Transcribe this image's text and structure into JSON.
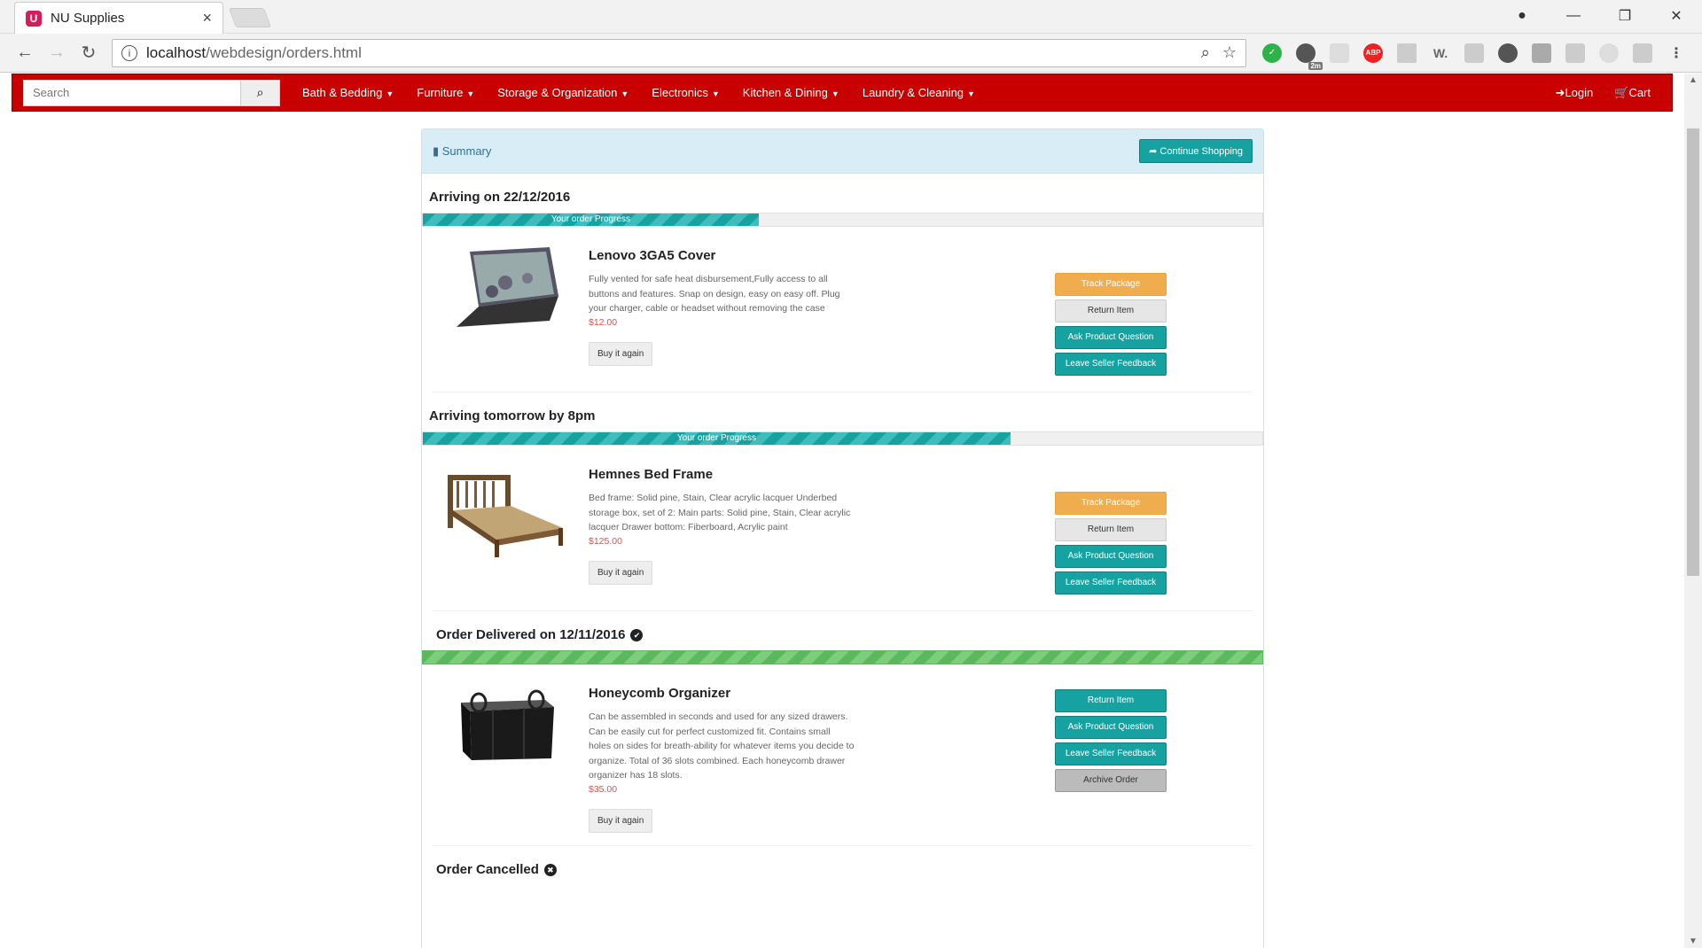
{
  "browser": {
    "tab_title": "NU Supplies",
    "favicon_text": "U",
    "url_host": "localhost",
    "url_path": "/webdesign/orders.html",
    "ext_badge": "2m"
  },
  "navbar": {
    "search_placeholder": "Search",
    "items": [
      "Bath & Bedding",
      "Furniture",
      "Storage & Organization",
      "Electronics",
      "Kitchen & Dining",
      "Laundry & Cleaning"
    ],
    "login": "Login",
    "cart": "Cart",
    "bg_color": "#c80000"
  },
  "summary": {
    "title": "Summary",
    "continue_label": "Continue Shopping"
  },
  "orders": [
    {
      "status": "Arriving on 22/12/2016",
      "progress_label": "Your order Progress",
      "progress": 0.4,
      "product": "Lenovo 3GA5 Cover",
      "description": "Fully vented for safe heat disbursement,Fully access to all buttons and features. Snap on design, easy on easy off. Plug your charger, cable or headset without removing the case",
      "price": "$12.00",
      "buy_again": "Buy it again",
      "actions": [
        "Track Package",
        "Return Item",
        "Ask Product Question",
        "Leave Seller Feedback"
      ]
    },
    {
      "status": "Arriving tomorrow by 8pm",
      "progress_label": "Your order Progress",
      "progress": 0.7,
      "product": "Hemnes Bed Frame",
      "description": "Bed frame: Solid pine, Stain, Clear acrylic lacquer Underbed storage box, set of 2: Main parts: Solid pine, Stain, Clear acrylic lacquer Drawer bottom: Fiberboard, Acrylic paint",
      "price": "$125.00",
      "buy_again": "Buy it again",
      "actions": [
        "Track Package",
        "Return Item",
        "Ask Product Question",
        "Leave Seller Feedback"
      ]
    },
    {
      "status": "Order Delivered on 12/11/2016",
      "progress": 1.0,
      "product": "Honeycomb Organizer",
      "description": "Can be assembled in seconds and used for any sized drawers. Can be easily cut for perfect customized fit. Contains small holes on sides for breath-ability for whatever items you decide to organize. Total of 36 slots combined. Each honeycomb drawer organizer has 18 slots.",
      "price": "$35.00",
      "buy_again": "Buy it again",
      "actions": [
        "Return Item",
        "Ask Product Question",
        "Leave Seller Feedback",
        "Archive Order"
      ]
    }
  ],
  "cancelled_title": "Order Cancelled"
}
